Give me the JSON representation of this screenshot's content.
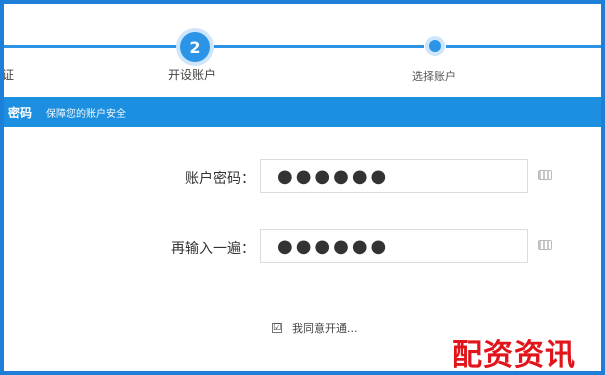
{
  "steps": {
    "step1_label": "证",
    "step2_number": "2",
    "step2_label": "开设账户",
    "step3_label": "选择账户"
  },
  "banner": {
    "title": "密码",
    "subtitle": "保障您的账户安全"
  },
  "form": {
    "account_password": {
      "label": "账户密码：",
      "value": "●●●●●●",
      "keyboard_icon": "keyboard-icon"
    },
    "confirm_password": {
      "label": "再输入一遍：",
      "value": "●●●●●●",
      "keyboard_icon": "keyboard-icon"
    }
  },
  "agreement": {
    "checked": true,
    "check_mark": "☑",
    "text": "我同意开通..."
  },
  "watermark": {
    "text": "配资资讯"
  },
  "colors": {
    "accent": "#2b94e6",
    "banner": "#1c8fe0",
    "frame": "#1e7fd8",
    "watermark": "#e1141b"
  }
}
